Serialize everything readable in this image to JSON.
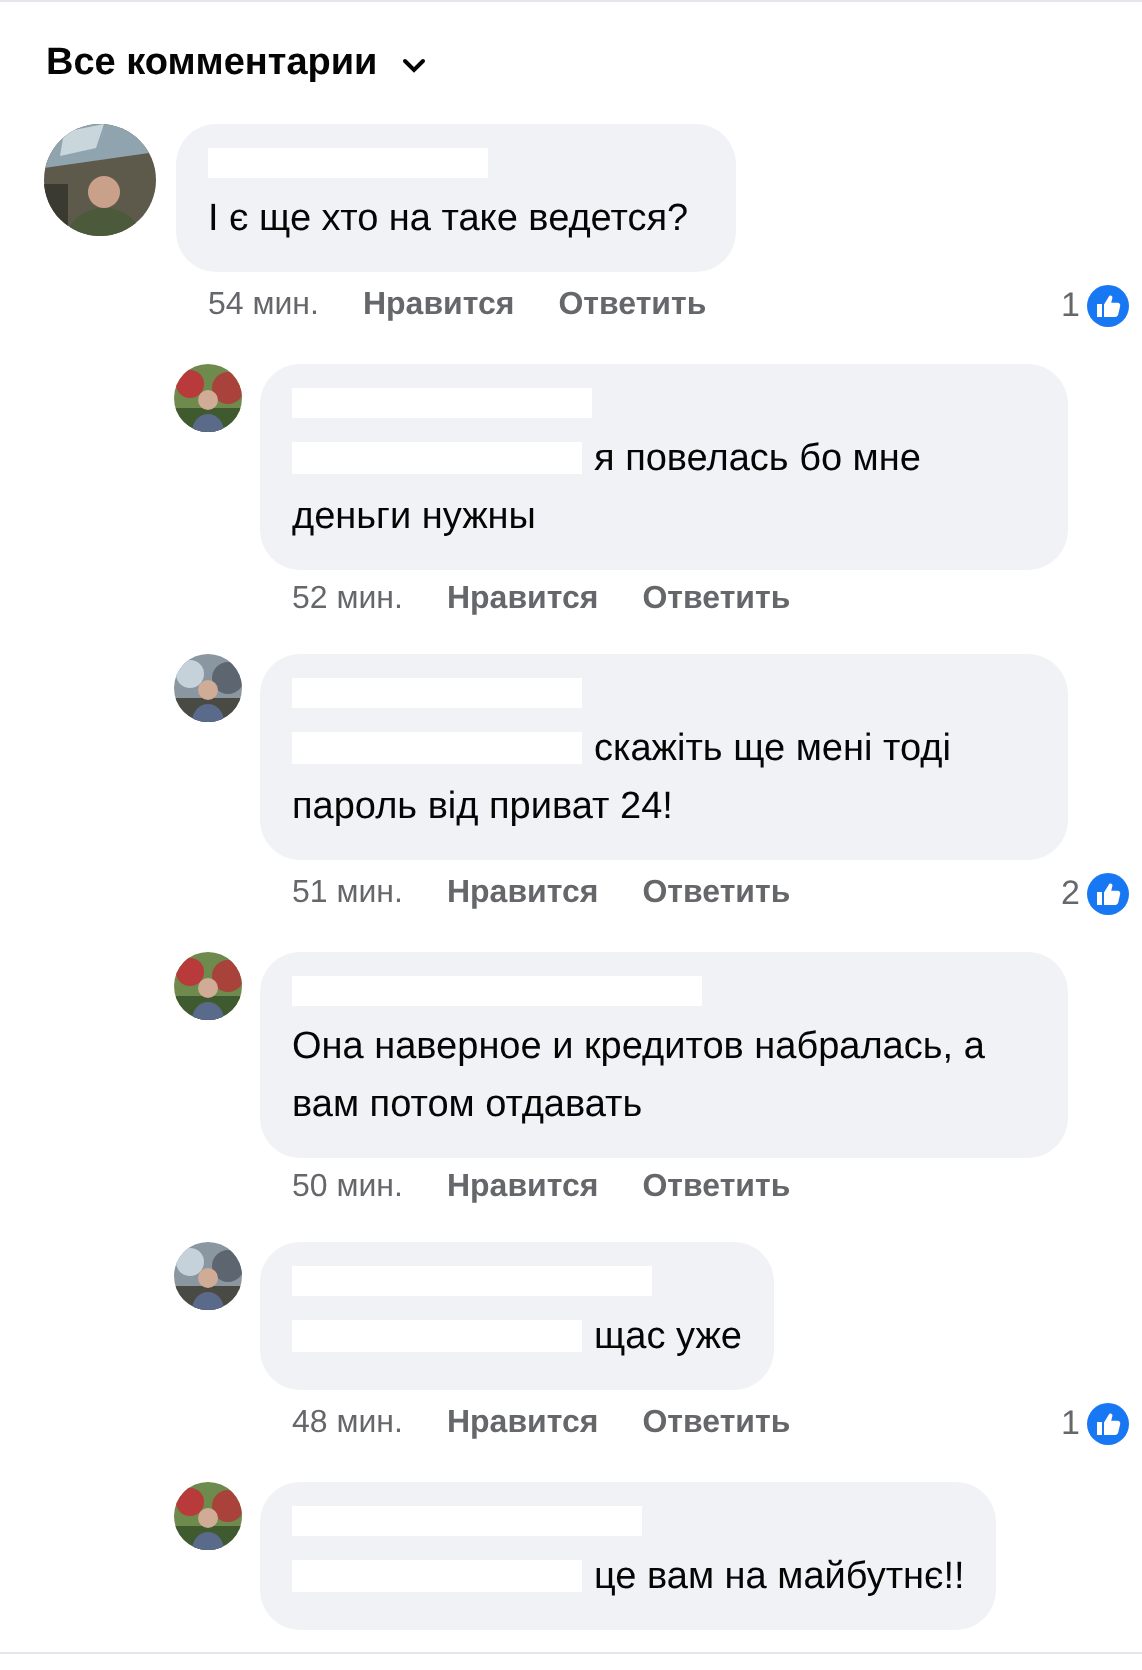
{
  "header": {
    "title": "Все комментарии"
  },
  "comments": [
    {
      "text": "І є ще хто на таке ведется?",
      "mention": false,
      "time": "54 мин.",
      "like_label": "Нравится",
      "reply_label": "Ответить",
      "likes": "1",
      "children": [
        {
          "text": "я повелась бо мне деньги нужны",
          "mention": true,
          "time": "52 мин.",
          "like_label": "Нравится",
          "reply_label": "Ответить"
        },
        {
          "text": "скажіть ще мені тоді пароль від приват 24!",
          "mention": true,
          "time": "51 мин.",
          "like_label": "Нравится",
          "reply_label": "Ответить",
          "likes": "2"
        },
        {
          "text": "Она наверное и кредитов набралась, а вам потом отдавать",
          "mention": false,
          "time": "50 мин.",
          "like_label": "Нравится",
          "reply_label": "Ответить"
        },
        {
          "text": "щас уже",
          "mention": true,
          "time": "48 мин.",
          "like_label": "Нравится",
          "reply_label": "Ответить",
          "likes": "1"
        },
        {
          "text": "це вам на майбутнє!!",
          "mention": true
        }
      ]
    }
  ]
}
